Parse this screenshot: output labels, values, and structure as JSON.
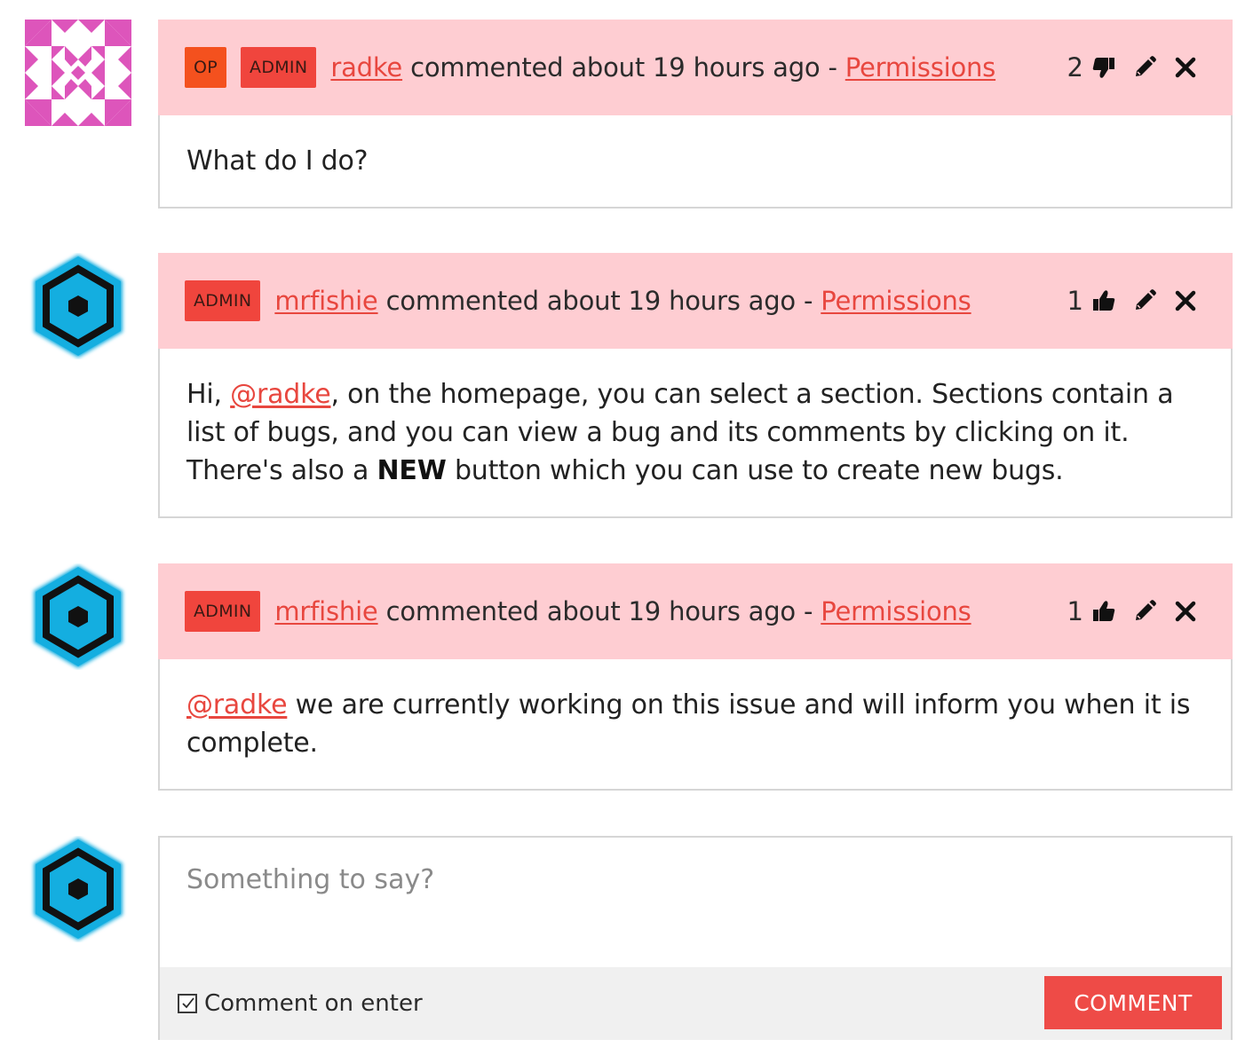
{
  "comments": [
    {
      "avatar": "identicon-pink",
      "badges": [
        "OP",
        "ADMIN"
      ],
      "author": "radke",
      "action": "commented about 19 hours ago -",
      "section": "Permissions",
      "votes": "2",
      "vote_icon": "thumbs-down-icon",
      "body_parts": {
        "text": "What do I do?"
      }
    },
    {
      "avatar": "hexagon-blue",
      "badges": [
        "ADMIN"
      ],
      "author": "mrfishie",
      "action": "commented about 19 hours ago -",
      "section": "Permissions",
      "votes": "1",
      "vote_icon": "thumbs-up-icon",
      "body_parts": {
        "prefix": "Hi, ",
        "mention": "@radke",
        "middle": ", on the homepage, you can select a section. Sections contain a list of bugs, and you can view a bug and its comments by clicking on it. There's also a ",
        "bold": "NEW",
        "suffix": " button which you can use to create new bugs."
      }
    },
    {
      "avatar": "hexagon-blue",
      "badges": [
        "ADMIN"
      ],
      "author": "mrfishie",
      "action": "commented about 19 hours ago -",
      "section": "Permissions",
      "votes": "1",
      "vote_icon": "thumbs-up-icon",
      "body_parts": {
        "mention": "@radke",
        "suffix": " we are currently working on this issue and will inform you when it is complete."
      }
    }
  ],
  "composer": {
    "avatar": "hexagon-blue",
    "placeholder": "Something to say?",
    "comment_on_enter_label": "Comment on enter",
    "comment_on_enter_checked": true,
    "submit_label": "COMMENT"
  },
  "colors": {
    "header_bg": "#fecdd2",
    "accent": "#e8473f",
    "badge_op": "#f4511e",
    "badge_admin": "#f0453d",
    "button": "#ee4b47",
    "avatar_hex": "#14aee0",
    "identicon": "#dd55bb"
  }
}
